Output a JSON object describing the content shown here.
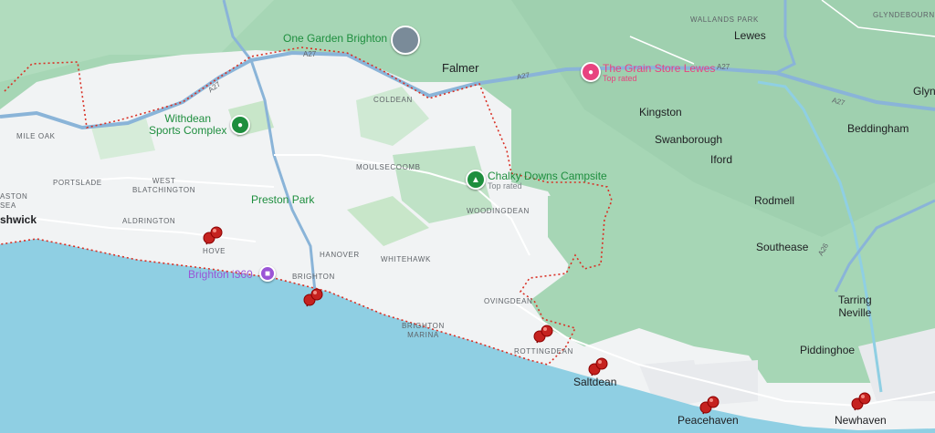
{
  "colors": {
    "sea": "#8fcfe3",
    "land_green": "#a6d6b5",
    "urban": "#f1f3f4",
    "park_green": "#c8e6c9",
    "boundary": "#d93025",
    "road_major": "#8ab4d8",
    "pin": "#c5221f"
  },
  "icons": {
    "park": "tree-icon",
    "campsite": "tent-icon",
    "shop": "shopping-bag-icon",
    "attraction": "camera-icon"
  },
  "places": {
    "one_garden": "One Garden Brighton",
    "falmer": "Falmer",
    "grain_store": "The Grain Store Lewes",
    "grain_store_sub": "Top rated",
    "wallands_park": "WALLANDS PARK",
    "lewes": "Lewes",
    "glyndebourne": "GLYNDEBOURNE",
    "glyn": "Glyn",
    "kingston": "Kingston",
    "swanborough": "Swanborough",
    "iford": "Iford",
    "beddingham": "Beddingham",
    "rodmell": "Rodmell",
    "southease": "Southease",
    "tarring_neville": "Tarring\nNeville",
    "piddinghoe": "Piddinghoe",
    "newhaven": "Newhaven",
    "peacehaven": "Peacehaven",
    "saltdean": "Saltdean",
    "rottingdean": "ROTTINGDEAN",
    "ovingdean": "OVINGDEAN",
    "brighton_marina": "BRIGHTON\nMARINA",
    "woodingdean": "WOODINGDEAN",
    "chalky_downs": "Chalky Downs Campsite",
    "chalky_downs_sub": "Top rated",
    "whitehawk": "WHITEHAWK",
    "hanover": "HANOVER",
    "brighton": "BRIGHTON",
    "brighton_i360": "Brighton i360",
    "preston_park": "Preston Park",
    "moulsecoomb": "MOULSECOOMB",
    "coldean": "COLDEAN",
    "withdean": "Withdean\nSports Complex",
    "mile_oak": "MILE OAK",
    "portslade": "PORTSLADE",
    "west_blatchington": "WEST\nBLATCHINGTON",
    "aldrington": "ALDRINGTON",
    "hove": "HOVE",
    "aston_sea": "ASTON\nSEA",
    "shwick": "shwick"
  },
  "roads": {
    "a27_west": "A27",
    "a27_mid": "A27",
    "a27_east1": "A27",
    "a27_east2": "A27",
    "a26": "A26"
  },
  "pins": [
    {
      "name": "hove"
    },
    {
      "name": "brighton-pier"
    },
    {
      "name": "rottingdean"
    },
    {
      "name": "saltdean"
    },
    {
      "name": "peacehaven"
    },
    {
      "name": "newhaven"
    }
  ]
}
